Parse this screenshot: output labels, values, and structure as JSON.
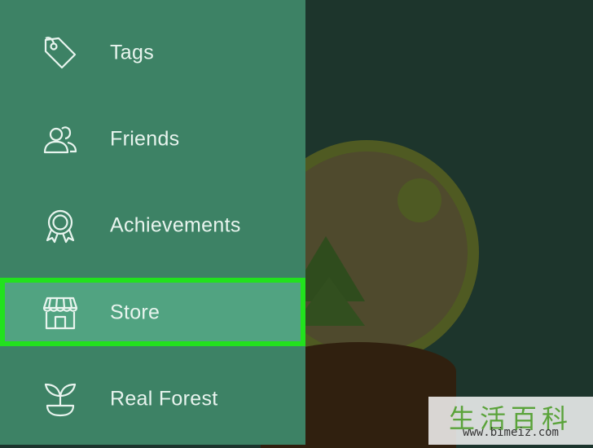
{
  "menu": {
    "items": [
      {
        "label": "Tags",
        "icon": "tag-icon"
      },
      {
        "label": "Friends",
        "icon": "friends-icon"
      },
      {
        "label": "Achievements",
        "icon": "achievement-ribbon-icon"
      },
      {
        "label": "Store",
        "icon": "storefront-icon",
        "selected": true
      },
      {
        "label": "Real Forest",
        "icon": "sprout-icon"
      }
    ]
  },
  "colors": {
    "sidebar": "#3d8265",
    "selected_item": "#51a381",
    "highlight_border": "#22e11e",
    "background": "#1d352c",
    "text": "#e8f4ee"
  },
  "watermark": {
    "chinese": "生活百科",
    "url": "www.bimeiz.com"
  }
}
